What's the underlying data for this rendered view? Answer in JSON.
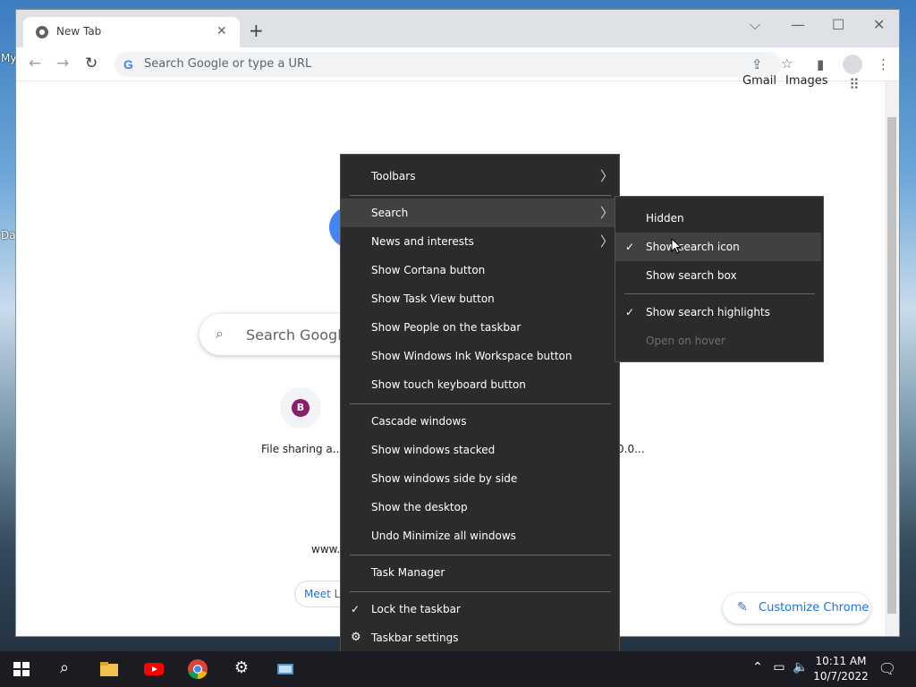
{
  "desktop": {
    "labels": [
      "My",
      "Da"
    ]
  },
  "browser": {
    "tab_title": "New Tab",
    "omnibox_placeholder": "Search Google or type a URL",
    "top_links": [
      "Gmail",
      "Images"
    ],
    "search_placeholder": "Search Google",
    "shortcuts": [
      {
        "letter": "B",
        "label": "File sharing a..."
      },
      {
        "label": "www."
      },
      {
        "label": "0.0..."
      }
    ],
    "meet_chip": "Meet La",
    "customize_label": "Customize Chrome"
  },
  "context_menu": {
    "items": [
      {
        "label": "Toolbars",
        "submenu": true
      },
      {
        "label": "Search",
        "submenu": true,
        "highlighted": true
      },
      {
        "label": "News and interests",
        "submenu": true
      },
      {
        "label": "Show Cortana button"
      },
      {
        "label": "Show Task View button"
      },
      {
        "label": "Show People on the taskbar"
      },
      {
        "label": "Show Windows Ink Workspace button"
      },
      {
        "label": "Show touch keyboard button"
      },
      {
        "label": "Cascade windows"
      },
      {
        "label": "Show windows stacked"
      },
      {
        "label": "Show windows side by side"
      },
      {
        "label": "Show the desktop"
      },
      {
        "label": "Undo Minimize all windows"
      },
      {
        "label": "Task Manager"
      },
      {
        "label": "Lock the taskbar",
        "checked": true
      },
      {
        "label": "Taskbar settings",
        "icon": "gear-icon"
      }
    ]
  },
  "search_submenu": {
    "items": [
      {
        "label": "Hidden"
      },
      {
        "label": "Show search icon",
        "checked": true,
        "highlighted": true
      },
      {
        "label": "Show search box"
      },
      {
        "label": "Show search highlights",
        "checked": true
      },
      {
        "label": "Open on hover",
        "disabled": true
      }
    ]
  },
  "taskbar": {
    "apps": [
      "start-icon",
      "search-icon",
      "file-explorer-icon",
      "youtube-icon",
      "chrome-icon",
      "settings-icon",
      "app-icon"
    ],
    "time": "10:11 AM",
    "date": "10/7/2022"
  },
  "colors": {
    "menu_bg": "#2b2b2b",
    "menu_highlight": "#414141",
    "accent_blue": "#1a73e8",
    "taskbar_bg": "#1b1c22"
  }
}
